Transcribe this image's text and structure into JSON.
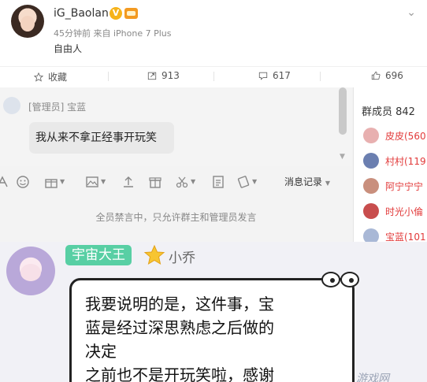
{
  "post": {
    "username": "iG_Baolan",
    "verified_mark": "V",
    "meta": "45分钟前 来自 iPhone 7 Plus",
    "text": "自由人"
  },
  "actions": {
    "favorite_label": "收藏",
    "repost_count": "913",
    "comment_count": "617",
    "like_count": "696"
  },
  "qq": {
    "sender": "[管理员] 宝蓝",
    "message": "我从来不拿正经事开玩笑",
    "history_button": "消息记录",
    "notice": "全员禁言中，只允许群主和管理员发言",
    "members_title": "群成员 842",
    "members": [
      {
        "name": "皮皮(560",
        "color": "#e8b0b0"
      },
      {
        "name": "村村(119",
        "color": "#6b7fb0"
      },
      {
        "name": "阿宁宁宁",
        "color": "#c98f7d"
      },
      {
        "name": "时光小倫",
        "color": "#c84d4d"
      },
      {
        "name": "宝蓝(101",
        "color": "#a9b8d6"
      }
    ]
  },
  "chat": {
    "rank_badge": "宇宙大王",
    "nickname": "小乔",
    "message_lines": [
      "我要说明的是，这件事，宝",
      "蓝是经过深思熟虑之后做的",
      "决定",
      "之前也不是开玩笑啦，感谢"
    ],
    "watermark": "游戏网"
  },
  "colors": {
    "badge_green": "#58cfa4",
    "member_red": "#e23a3a",
    "verified_gold": "#f6b31a"
  }
}
